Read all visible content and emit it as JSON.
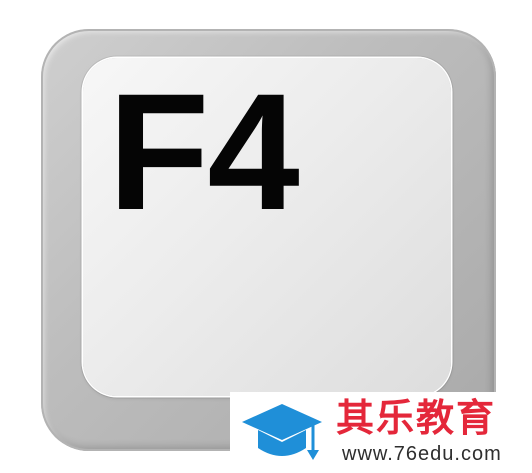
{
  "key": {
    "label": "F4"
  },
  "watermark": {
    "icon": "graduation-cap-icon",
    "title": "其乐教育",
    "url": "www.76edu.com"
  },
  "colors": {
    "key_label": "#050505",
    "key_rim": "#bdbdbd",
    "key_face": "#ececec",
    "brand_red": "#e4273a",
    "brand_blue": "#1f8fd8"
  }
}
